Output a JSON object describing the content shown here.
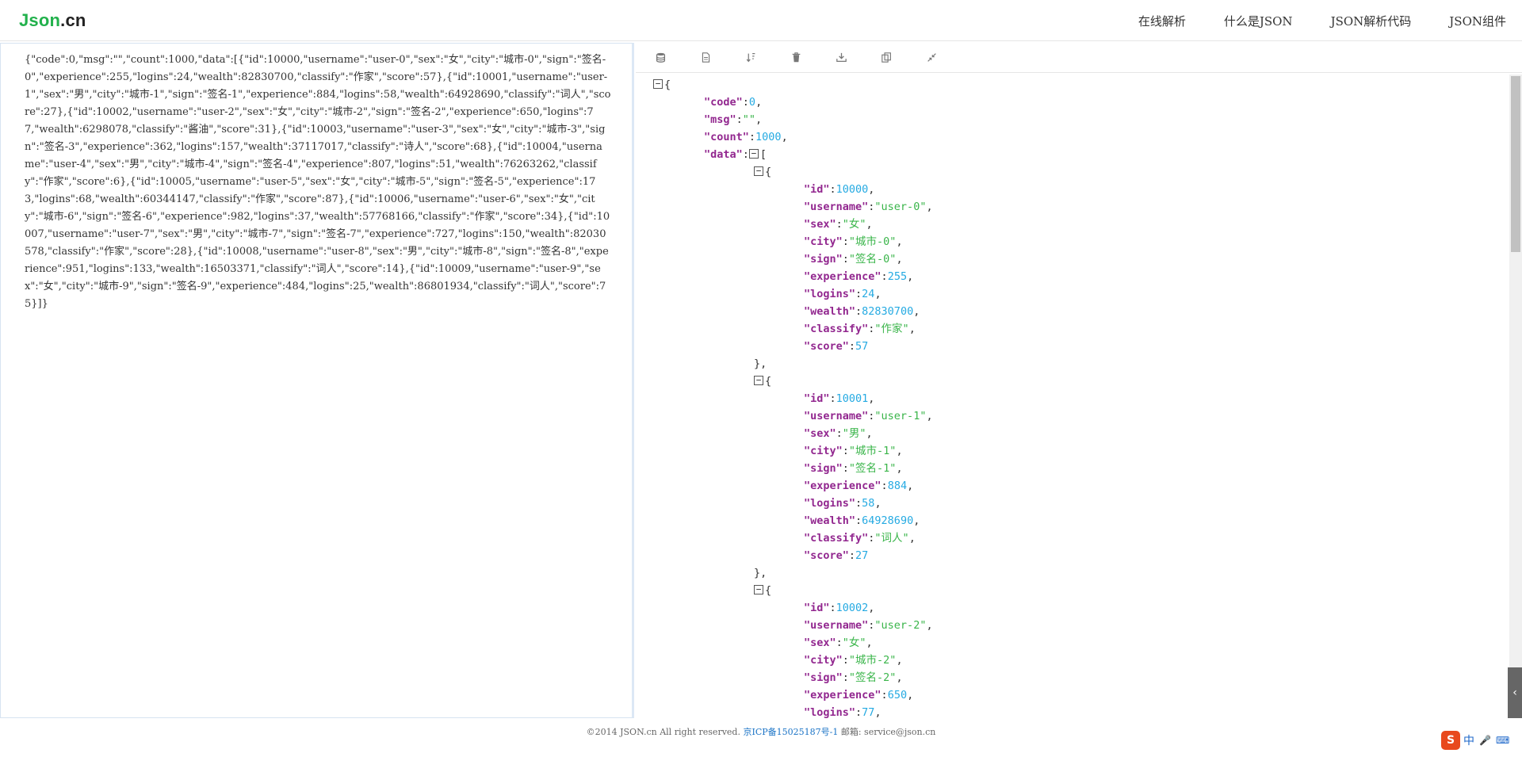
{
  "header": {
    "logo_part1": "Json",
    "logo_part2": ".cn",
    "nav": [
      "在线解析",
      "什么是JSON",
      "JSON解析代码",
      "JSON组件"
    ]
  },
  "input": {
    "text": "{\"code\":0,\"msg\":\"\",\"count\":1000,\"data\":[{\"id\":10000,\"username\":\"user-0\",\"sex\":\"女\",\"city\":\"城市-0\",\"sign\":\"签名-0\",\"experience\":255,\"logins\":24,\"wealth\":82830700,\"classify\":\"作家\",\"score\":57},{\"id\":10001,\"username\":\"user-1\",\"sex\":\"男\",\"city\":\"城市-1\",\"sign\":\"签名-1\",\"experience\":884,\"logins\":58,\"wealth\":64928690,\"classify\":\"词人\",\"score\":27},{\"id\":10002,\"username\":\"user-2\",\"sex\":\"女\",\"city\":\"城市-2\",\"sign\":\"签名-2\",\"experience\":650,\"logins\":77,\"wealth\":6298078,\"classify\":\"酱油\",\"score\":31},{\"id\":10003,\"username\":\"user-3\",\"sex\":\"女\",\"city\":\"城市-3\",\"sign\":\"签名-3\",\"experience\":362,\"logins\":157,\"wealth\":37117017,\"classify\":\"诗人\",\"score\":68},{\"id\":10004,\"username\":\"user-4\",\"sex\":\"男\",\"city\":\"城市-4\",\"sign\":\"签名-4\",\"experience\":807,\"logins\":51,\"wealth\":76263262,\"classify\":\"作家\",\"score\":6},{\"id\":10005,\"username\":\"user-5\",\"sex\":\"女\",\"city\":\"城市-5\",\"sign\":\"签名-5\",\"experience\":173,\"logins\":68,\"wealth\":60344147,\"classify\":\"作家\",\"score\":87},{\"id\":10006,\"username\":\"user-6\",\"sex\":\"女\",\"city\":\"城市-6\",\"sign\":\"签名-6\",\"experience\":982,\"logins\":37,\"wealth\":57768166,\"classify\":\"作家\",\"score\":34},{\"id\":10007,\"username\":\"user-7\",\"sex\":\"男\",\"city\":\"城市-7\",\"sign\":\"签名-7\",\"experience\":727,\"logins\":150,\"wealth\":82030578,\"classify\":\"作家\",\"score\":28},{\"id\":10008,\"username\":\"user-8\",\"sex\":\"男\",\"city\":\"城市-8\",\"sign\":\"签名-8\",\"experience\":951,\"logins\":133,\"wealth\":16503371,\"classify\":\"词人\",\"score\":14},{\"id\":10009,\"username\":\"user-9\",\"sex\":\"女\",\"city\":\"城市-9\",\"sign\":\"签名-9\",\"experience\":484,\"logins\":25,\"wealth\":86801934,\"classify\":\"词人\",\"score\":75}]}"
  },
  "toolbar": {
    "icons": [
      "database-icon",
      "document-icon",
      "sort-icon",
      "trash-icon",
      "download-icon",
      "copy-icon",
      "compress-icon"
    ]
  },
  "tree": {
    "root": [
      {
        "key": "code",
        "value": "0",
        "type": "num"
      },
      {
        "key": "msg",
        "value": "\"\"",
        "type": "str"
      },
      {
        "key": "count",
        "value": "1000",
        "type": "num"
      }
    ],
    "data_key": "data",
    "records": [
      [
        {
          "key": "id",
          "value": "10000",
          "type": "num"
        },
        {
          "key": "username",
          "value": "\"user-0\"",
          "type": "str"
        },
        {
          "key": "sex",
          "value": "\"女\"",
          "type": "str"
        },
        {
          "key": "city",
          "value": "\"城市-0\"",
          "type": "str"
        },
        {
          "key": "sign",
          "value": "\"签名-0\"",
          "type": "str"
        },
        {
          "key": "experience",
          "value": "255",
          "type": "num"
        },
        {
          "key": "logins",
          "value": "24",
          "type": "num"
        },
        {
          "key": "wealth",
          "value": "82830700",
          "type": "num"
        },
        {
          "key": "classify",
          "value": "\"作家\"",
          "type": "str"
        },
        {
          "key": "score",
          "value": "57",
          "type": "num"
        }
      ],
      [
        {
          "key": "id",
          "value": "10001",
          "type": "num"
        },
        {
          "key": "username",
          "value": "\"user-1\"",
          "type": "str"
        },
        {
          "key": "sex",
          "value": "\"男\"",
          "type": "str"
        },
        {
          "key": "city",
          "value": "\"城市-1\"",
          "type": "str"
        },
        {
          "key": "sign",
          "value": "\"签名-1\"",
          "type": "str"
        },
        {
          "key": "experience",
          "value": "884",
          "type": "num"
        },
        {
          "key": "logins",
          "value": "58",
          "type": "num"
        },
        {
          "key": "wealth",
          "value": "64928690",
          "type": "num"
        },
        {
          "key": "classify",
          "value": "\"词人\"",
          "type": "str"
        },
        {
          "key": "score",
          "value": "27",
          "type": "num"
        }
      ],
      [
        {
          "key": "id",
          "value": "10002",
          "type": "num"
        },
        {
          "key": "username",
          "value": "\"user-2\"",
          "type": "str"
        },
        {
          "key": "sex",
          "value": "\"女\"",
          "type": "str"
        },
        {
          "key": "city",
          "value": "\"城市-2\"",
          "type": "str"
        },
        {
          "key": "sign",
          "value": "\"签名-2\"",
          "type": "str"
        },
        {
          "key": "experience",
          "value": "650",
          "type": "num"
        },
        {
          "key": "logins",
          "value": "77",
          "type": "num"
        }
      ]
    ]
  },
  "footer": {
    "copyright": "©2014 JSON.cn All right reserved.",
    "icp": "京ICP备15025187号-1",
    "email": "邮箱: service@json.cn"
  },
  "side_tab": "‹",
  "ime": {
    "logo": "S",
    "lang": "中",
    "mic": "🎤",
    "keyboard": "⌨"
  }
}
